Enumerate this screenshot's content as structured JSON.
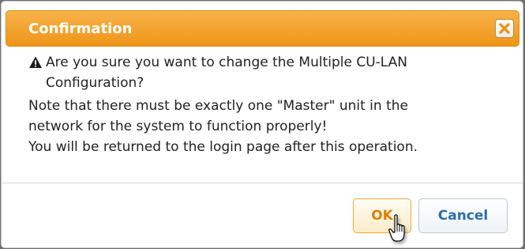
{
  "dialog": {
    "title": "Confirmation",
    "close_icon": "close-icon",
    "warning_icon": "warning-icon",
    "question": "Are you sure you want to change the Multiple CU-LAN Configuration?",
    "note_line1": "Note that there must be exactly one \"Master\" unit in the",
    "note_line2": "network for the system to function properly!",
    "returned": "You will be returned to the login page after this operation.",
    "ok_label": "OK",
    "cancel_label": "Cancel"
  },
  "colors": {
    "titlebar": "#f0a02c",
    "ok_text": "#df7f08",
    "cancel_text": "#2c6fa8"
  },
  "cursor_icon": "hand-pointer-icon"
}
